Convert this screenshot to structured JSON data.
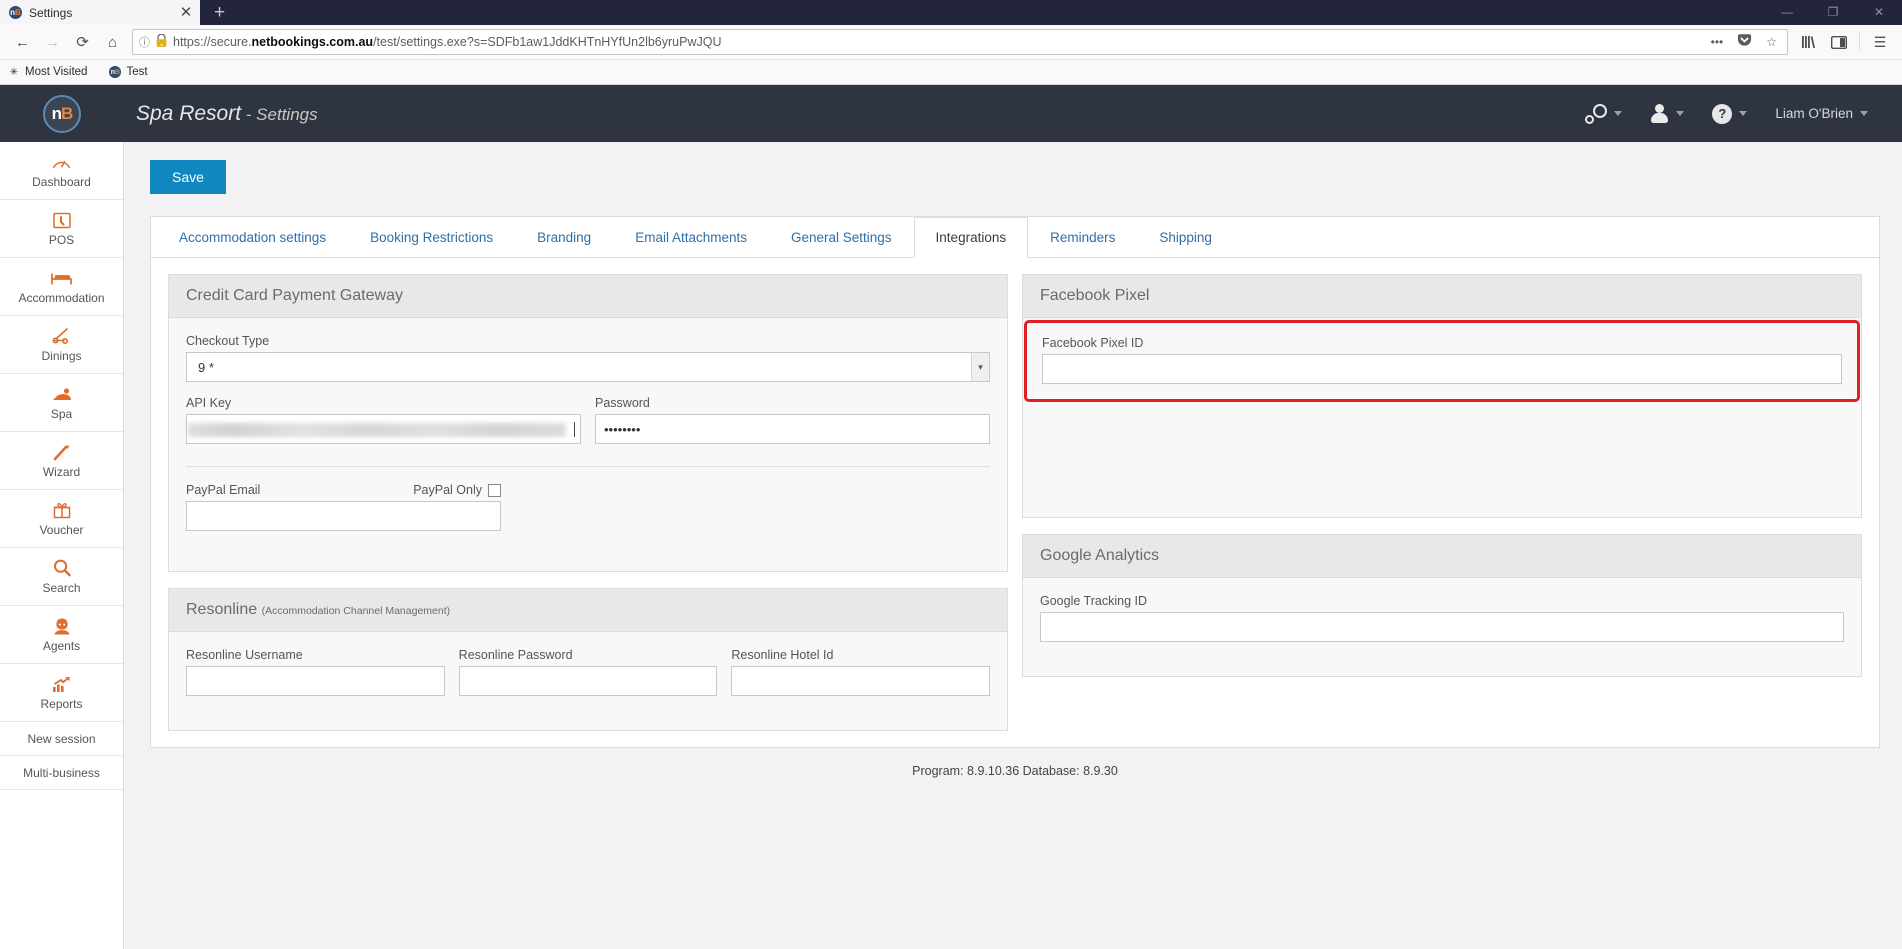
{
  "browser": {
    "tab_title": "Settings",
    "tab_favicon_n": "n",
    "tab_favicon_b": "B",
    "tab_close": "✕",
    "new_tab": "+",
    "window_minimize": "—",
    "window_maximize": "❐",
    "window_close": "✕",
    "nav_back": "←",
    "nav_forward": "→",
    "nav_reload": "⟳",
    "nav_home": "⌂",
    "identity_icon": "ⓘ",
    "lock_icon": "🔒",
    "url_prefix": "https://secure.",
    "url_domain": "netbookings.com.au",
    "url_path": "/test/settings.exe?s=SDFb1aw1JddKHTnHYfUn2lb6yruPwJQU",
    "url_full": "https://secure.netbookings.com.au/test/settings.exe?s=SDFb1aw1JddKHTnHYfUn2lb6yruPwJQU",
    "page_actions": "•••",
    "pocket_icon": "▼",
    "bookmark_star": "☆",
    "library_icon": "|||\\",
    "sidebar_icon": "◫",
    "menu_icon": "☰",
    "bookmarks": [
      {
        "label": "Most Visited",
        "icon": "star-outline-icon",
        "glyph": "✳"
      },
      {
        "label": "Test",
        "icon": "nb-favicon",
        "glyph": ""
      }
    ]
  },
  "app": {
    "logo_n": "n",
    "logo_b": "B",
    "title_main": "Spa Resort",
    "title_sep": " - ",
    "title_sub": "Settings",
    "header_menus": [
      {
        "name": "settings-menu",
        "icon": "gears-icon",
        "label": ""
      },
      {
        "name": "user-menu",
        "icon": "person-icon",
        "label": ""
      },
      {
        "name": "help-menu",
        "icon": "question-icon",
        "label": ""
      }
    ],
    "user_name": "Liam O'Brien"
  },
  "sidebar": {
    "items": [
      {
        "label": "Dashboard",
        "icon": "dashboard-icon",
        "glyph": "◔"
      },
      {
        "label": "POS",
        "icon": "pos-icon",
        "glyph": "▣"
      },
      {
        "label": "Accommodation",
        "icon": "bed-icon",
        "glyph": "☷"
      },
      {
        "label": "Dinings",
        "icon": "dining-icon",
        "glyph": "⑂"
      },
      {
        "label": "Spa",
        "icon": "spa-icon",
        "glyph": "♒"
      },
      {
        "label": "Wizard",
        "icon": "wand-icon",
        "glyph": "╱"
      },
      {
        "label": "Voucher",
        "icon": "gift-icon",
        "glyph": "☗"
      },
      {
        "label": "Search",
        "icon": "magnifier-icon",
        "glyph": "⌕"
      },
      {
        "label": "Agents",
        "icon": "agent-icon",
        "glyph": "☺"
      },
      {
        "label": "Reports",
        "icon": "chart-up-icon",
        "glyph": "↗"
      }
    ],
    "plain_items": [
      {
        "label": "New session"
      },
      {
        "label": "Multi-business"
      }
    ]
  },
  "toolbar": {
    "save_label": "Save"
  },
  "tabs": [
    {
      "label": "Accommodation settings",
      "active": false
    },
    {
      "label": "Booking Restrictions",
      "active": false
    },
    {
      "label": "Branding",
      "active": false
    },
    {
      "label": "Email Attachments",
      "active": false
    },
    {
      "label": "General Settings",
      "active": false
    },
    {
      "label": "Integrations",
      "active": true
    },
    {
      "label": "Reminders",
      "active": false
    },
    {
      "label": "Shipping",
      "active": false
    }
  ],
  "panels": {
    "credit_card": {
      "title": "Credit Card Payment Gateway",
      "checkout_type_label": "Checkout Type",
      "checkout_type_value": "9 *",
      "api_key_label": "API Key",
      "api_key_value": "",
      "password_label": "Password",
      "password_value": "••••••••",
      "paypal_email_label": "PayPal Email",
      "paypal_email_value": "",
      "paypal_only_label": "PayPal Only",
      "paypal_only_checked": false
    },
    "facebook_pixel": {
      "title": "Facebook Pixel",
      "pixel_id_label": "Facebook Pixel ID",
      "pixel_id_value": "",
      "highlight_color": "#e02020"
    },
    "resonline": {
      "title": "Resonline",
      "subtitle": "(Accommodation Channel Management)",
      "username_label": "Resonline Username",
      "username_value": "",
      "password_label": "Resonline Password",
      "password_value": "",
      "hotel_id_label": "Resonline Hotel Id",
      "hotel_id_value": ""
    },
    "google_analytics": {
      "title": "Google Analytics",
      "tracking_id_label": "Google Tracking ID",
      "tracking_id_value": ""
    }
  },
  "footer": {
    "text": "Program: 8.9.10.36 Database: 8.9.30"
  }
}
